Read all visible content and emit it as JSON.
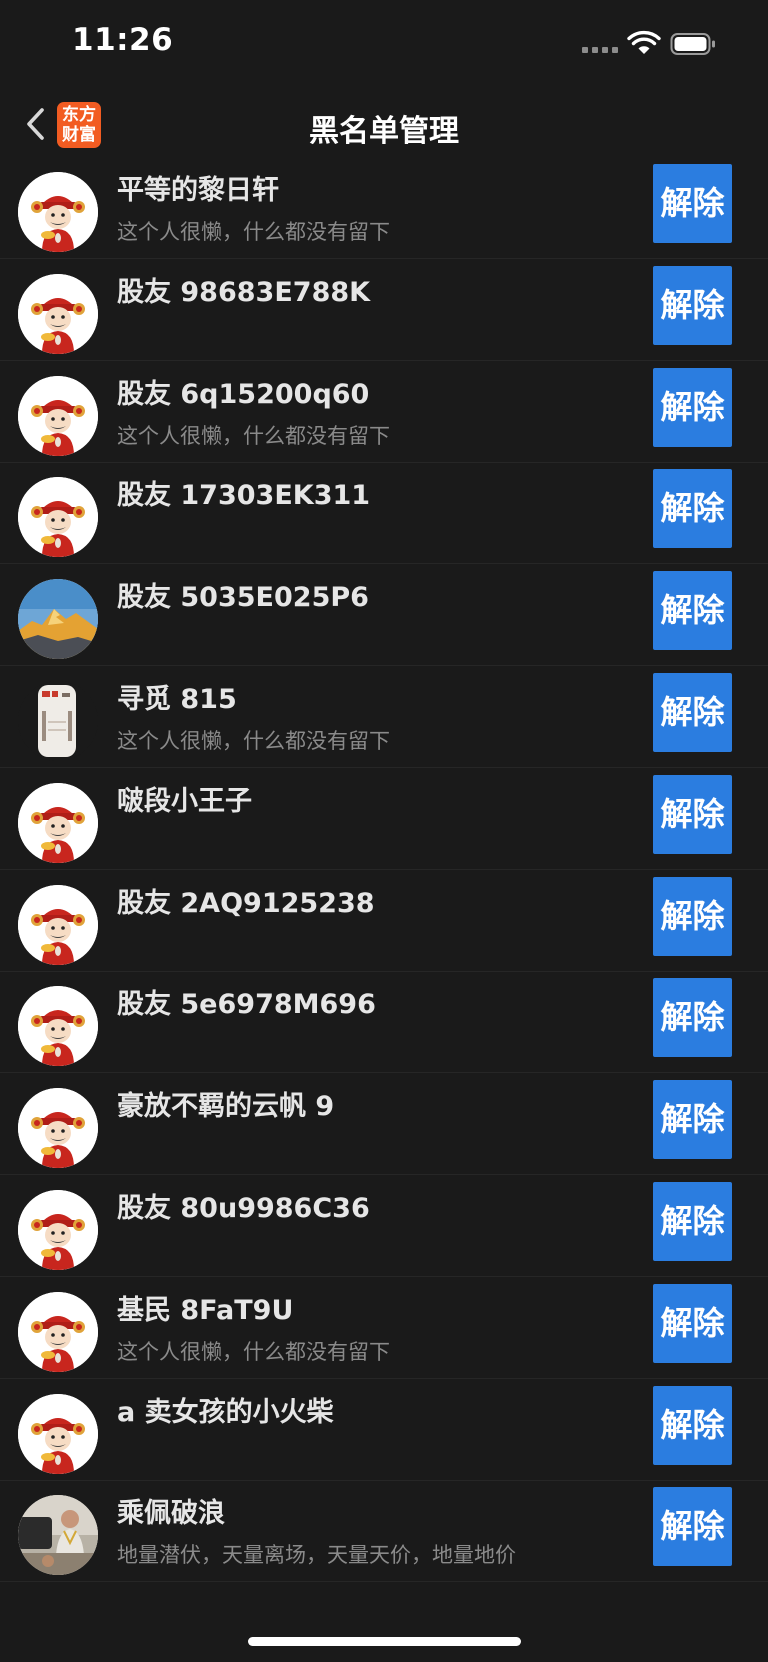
{
  "status": {
    "time": "11:26"
  },
  "nav": {
    "title": "黑名单管理",
    "logo_line1": "东方",
    "logo_line2": "财富"
  },
  "colors": {
    "background": "#1a1a1a",
    "button": "#2b7de0",
    "logo": "#f25c22"
  },
  "rows": [
    {
      "name": "平等的黎日轩",
      "subtitle": "这个人很懒，什么都没有留下",
      "avatar": "caishen",
      "button": "解除"
    },
    {
      "name": "股友 98683E788K",
      "subtitle": "",
      "avatar": "caishen",
      "button": "解除"
    },
    {
      "name": "股友 6q15200q60",
      "subtitle": "这个人很懒，什么都没有留下",
      "avatar": "caishen",
      "button": "解除"
    },
    {
      "name": "股友 17303EK311",
      "subtitle": "",
      "avatar": "caishen",
      "button": "解除"
    },
    {
      "name": "股友 5035E025P6",
      "subtitle": "",
      "avatar": "mountain",
      "button": "解除"
    },
    {
      "name": "寻觅 815",
      "subtitle": "这个人很懒，什么都没有留下",
      "avatar": "photo-cup",
      "button": "解除"
    },
    {
      "name": "啵段小王子",
      "subtitle": "",
      "avatar": "caishen",
      "button": "解除"
    },
    {
      "name": "股友 2AQ9125238",
      "subtitle": "",
      "avatar": "caishen",
      "button": "解除"
    },
    {
      "name": "股友 5e6978M696",
      "subtitle": "",
      "avatar": "caishen",
      "button": "解除"
    },
    {
      "name": "豪放不羁的云帆 9",
      "subtitle": "",
      "avatar": "caishen",
      "button": "解除"
    },
    {
      "name": "股友 80u9986C36",
      "subtitle": "",
      "avatar": "caishen",
      "button": "解除"
    },
    {
      "name": "基民 8FaT9U",
      "subtitle": "这个人很懒，什么都没有留下",
      "avatar": "caishen",
      "button": "解除"
    },
    {
      "name": "a 卖女孩的小火柴",
      "subtitle": "",
      "avatar": "caishen",
      "button": "解除"
    },
    {
      "name": "乘佩破浪",
      "subtitle": "地量潜伏，天量离场，天量天价，地量地价",
      "avatar": "photo-person",
      "button": "解除"
    }
  ]
}
